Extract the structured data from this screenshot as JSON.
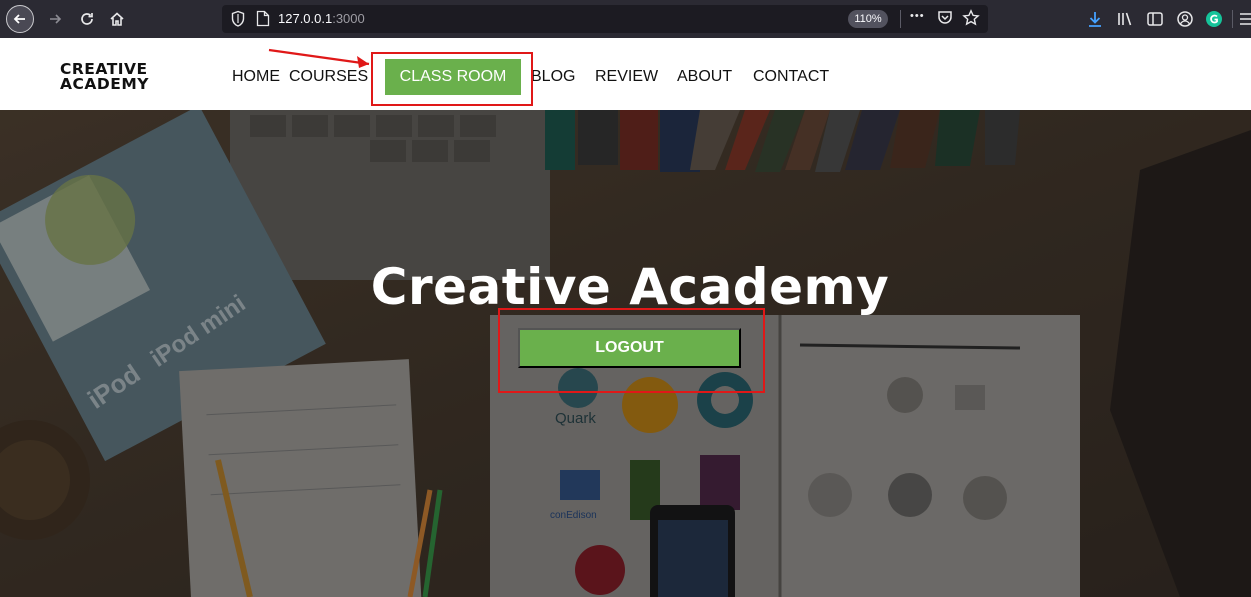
{
  "browser": {
    "url_host": "127.0.0.1",
    "url_port": ":3000",
    "zoom": "110%",
    "menu_dots": "•••"
  },
  "site": {
    "logo_line1": "CREATIVE",
    "logo_line2": "ACADEMY",
    "nav": {
      "home": "HOME",
      "courses": "COURSES",
      "classroom": "CLASS ROOM",
      "blog": "BLOG",
      "review": "REVIEW",
      "about": "ABOUT",
      "contact": "CONTACT"
    }
  },
  "hero": {
    "title": "Creative Academy",
    "logout_label": "LOGOUT",
    "bg_text": {
      "ipod": "iPod",
      "ipod_mini": "iPod mini",
      "quark": "Quark",
      "conedison": "conEdison"
    }
  },
  "colors": {
    "accent_green": "#6ab04c",
    "annotation_red": "#e01818",
    "chrome_dark": "#2b2a33"
  }
}
